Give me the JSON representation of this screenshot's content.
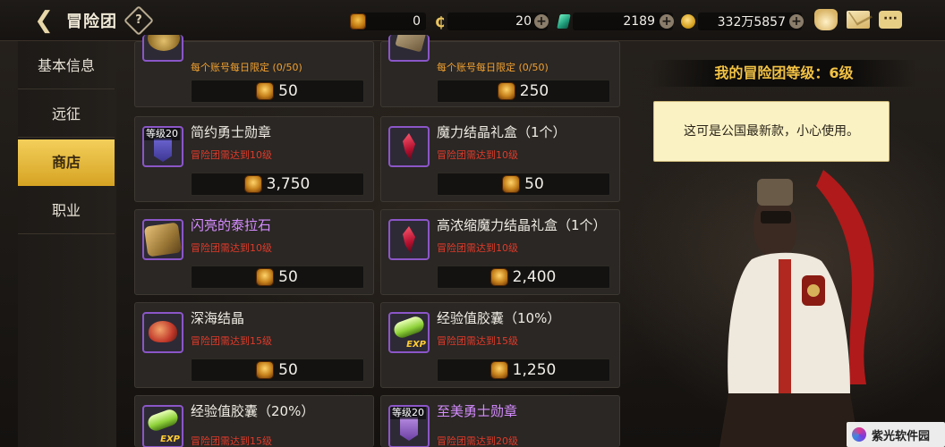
{
  "header": {
    "title": "冒险团",
    "currencies": [
      {
        "icon": "trophy-icon",
        "value": "0"
      },
      {
        "icon": "c-coin-icon",
        "value": "20"
      },
      {
        "icon": "green-gem-icon",
        "value": "2189"
      },
      {
        "icon": "gold-coin-icon",
        "value": "332万5857"
      }
    ]
  },
  "sidebar": {
    "items": [
      {
        "label": "基本信息",
        "active": false
      },
      {
        "label": "远征",
        "active": false
      },
      {
        "label": "商店",
        "active": true
      },
      {
        "label": "职业",
        "active": false
      }
    ]
  },
  "shop": {
    "items": [
      {
        "name": "",
        "req": "每个账号每日限定 (0/50)",
        "price": "50",
        "icon": "gold-coins-icon",
        "level_tag": ""
      },
      {
        "name": "",
        "req": "每个账号每日限定 (0/50)",
        "price": "250",
        "icon": "scroll-icon",
        "level_tag": ""
      },
      {
        "name": "简约勇士勋章",
        "req": "冒险团需达到10级",
        "price": "3,750",
        "icon": "warrior-badge-icon",
        "level_tag": "等级20"
      },
      {
        "name": "魔力结晶礼盒（1个）",
        "req": "冒险团需达到10级",
        "price": "50",
        "icon": "red-crystal-icon",
        "level_tag": ""
      },
      {
        "name": "闪亮的泰拉石",
        "req": "冒险团需达到10级",
        "price": "50",
        "icon": "terra-stone-icon",
        "level_tag": ""
      },
      {
        "name": "高浓缩魔力结晶礼盒（1个）",
        "req": "冒险团需达到10级",
        "price": "2,400",
        "icon": "red-crystal-icon",
        "level_tag": ""
      },
      {
        "name": "深海结晶",
        "req": "冒险团需达到15级",
        "price": "50",
        "icon": "deep-sea-crystal-icon",
        "level_tag": ""
      },
      {
        "name": "经验值胶囊（10%）",
        "req": "冒险团需达到15级",
        "price": "1,250",
        "icon": "exp-capsule-icon",
        "level_tag": ""
      },
      {
        "name": "经验值胶囊（20%）",
        "req": "冒险团需达到15级",
        "price": "",
        "icon": "exp-capsule-icon",
        "level_tag": ""
      },
      {
        "name": "至美勇士勋章",
        "req": "冒险团需达到20级",
        "price": "",
        "icon": "warrior-badge-icon",
        "level_tag": "等级20"
      }
    ],
    "exp_label": "EXP"
  },
  "npc": {
    "level_text": "我的冒险团等级：6级",
    "speech": "这可是公国最新款，小心使用。"
  },
  "watermark": {
    "text": "紫光软件园"
  },
  "colors": {
    "accent_gold": "#f2c244",
    "active_tab": "#e3b23a",
    "requirement_red": "#e03a2a",
    "limit_orange": "#f0a030",
    "purple_name": "#d58cff",
    "icon_border": "#8b56c8"
  }
}
